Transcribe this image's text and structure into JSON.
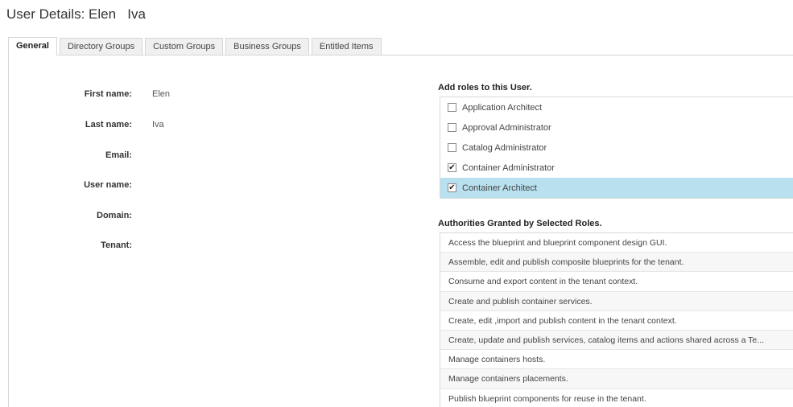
{
  "header": {
    "title": "User Details: Elen   Iva"
  },
  "tabs": [
    {
      "label": "General",
      "active": true
    },
    {
      "label": "Directory Groups"
    },
    {
      "label": "Custom Groups"
    },
    {
      "label": "Business Groups"
    },
    {
      "label": "Entitled Items"
    }
  ],
  "fields": {
    "first_name": {
      "label": "First name:",
      "value": "Elen"
    },
    "last_name": {
      "label": "Last name:",
      "value": "Iva"
    },
    "email": {
      "label": "Email:",
      "value": ""
    },
    "user_name": {
      "label": "User name:",
      "value": ""
    },
    "domain": {
      "label": "Domain:",
      "value": ""
    },
    "tenant": {
      "label": "Tenant:",
      "value": ""
    }
  },
  "roles": {
    "heading": "Add roles to this User.",
    "items": [
      {
        "label": "Application Architect",
        "checked": false
      },
      {
        "label": "Approval Administrator",
        "checked": false
      },
      {
        "label": "Catalog Administrator",
        "checked": false
      },
      {
        "label": "Container Administrator",
        "checked": true
      },
      {
        "label": "Container Architect",
        "checked": true,
        "selected": true
      }
    ],
    "check_glyph": "✔"
  },
  "authorities": {
    "heading": "Authorities Granted by Selected Roles.",
    "items": [
      "Access the blueprint and blueprint component design GUI.",
      "Assemble, edit and publish composite blueprints for the tenant.",
      "Consume and export content in the tenant context.",
      "Create and publish container services.",
      "Create, edit ,import and publish content in the tenant context.",
      "Create, update and publish services, catalog items and actions shared across a Te...",
      "Manage containers hosts.",
      "Manage containers placements.",
      "Publish blueprint components for reuse in the tenant."
    ]
  },
  "colors": {
    "selected_row": "#b8e0ee",
    "border": "#d6d6d6"
  }
}
